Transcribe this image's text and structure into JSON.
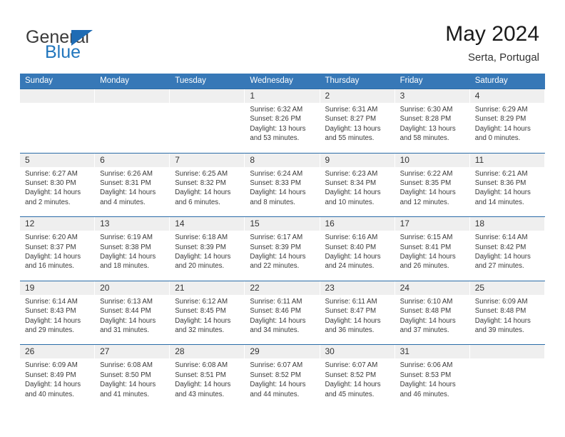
{
  "brand": {
    "name_top": "General",
    "name_bottom": "Blue",
    "triangle_icon": "blue-triangle-icon",
    "color_top": "#3b3b3b",
    "color_bottom": "#2176bd"
  },
  "header": {
    "title": "May 2024",
    "subtitle": "Serta, Portugal"
  },
  "theme": {
    "header_row_bg": "#3778b7",
    "row_separator": "#2b6ca8",
    "day_band_bg": "#efefef",
    "text": "#3a3a3a"
  },
  "calendar": {
    "day_names": [
      "Sunday",
      "Monday",
      "Tuesday",
      "Wednesday",
      "Thursday",
      "Friday",
      "Saturday"
    ],
    "labels": {
      "sunrise": "Sunrise:",
      "sunset": "Sunset:",
      "daylight": "Daylight:"
    },
    "weeks": [
      [
        {
          "day": "",
          "empty": true
        },
        {
          "day": "",
          "empty": true
        },
        {
          "day": "",
          "empty": true
        },
        {
          "day": "1",
          "sunrise": "Sunrise: 6:32 AM",
          "sunset": "Sunset: 8:26 PM",
          "daylight1": "Daylight: 13 hours",
          "daylight2": "and 53 minutes."
        },
        {
          "day": "2",
          "sunrise": "Sunrise: 6:31 AM",
          "sunset": "Sunset: 8:27 PM",
          "daylight1": "Daylight: 13 hours",
          "daylight2": "and 55 minutes."
        },
        {
          "day": "3",
          "sunrise": "Sunrise: 6:30 AM",
          "sunset": "Sunset: 8:28 PM",
          "daylight1": "Daylight: 13 hours",
          "daylight2": "and 58 minutes."
        },
        {
          "day": "4",
          "sunrise": "Sunrise: 6:29 AM",
          "sunset": "Sunset: 8:29 PM",
          "daylight1": "Daylight: 14 hours",
          "daylight2": "and 0 minutes."
        }
      ],
      [
        {
          "day": "5",
          "sunrise": "Sunrise: 6:27 AM",
          "sunset": "Sunset: 8:30 PM",
          "daylight1": "Daylight: 14 hours",
          "daylight2": "and 2 minutes."
        },
        {
          "day": "6",
          "sunrise": "Sunrise: 6:26 AM",
          "sunset": "Sunset: 8:31 PM",
          "daylight1": "Daylight: 14 hours",
          "daylight2": "and 4 minutes."
        },
        {
          "day": "7",
          "sunrise": "Sunrise: 6:25 AM",
          "sunset": "Sunset: 8:32 PM",
          "daylight1": "Daylight: 14 hours",
          "daylight2": "and 6 minutes."
        },
        {
          "day": "8",
          "sunrise": "Sunrise: 6:24 AM",
          "sunset": "Sunset: 8:33 PM",
          "daylight1": "Daylight: 14 hours",
          "daylight2": "and 8 minutes."
        },
        {
          "day": "9",
          "sunrise": "Sunrise: 6:23 AM",
          "sunset": "Sunset: 8:34 PM",
          "daylight1": "Daylight: 14 hours",
          "daylight2": "and 10 minutes."
        },
        {
          "day": "10",
          "sunrise": "Sunrise: 6:22 AM",
          "sunset": "Sunset: 8:35 PM",
          "daylight1": "Daylight: 14 hours",
          "daylight2": "and 12 minutes."
        },
        {
          "day": "11",
          "sunrise": "Sunrise: 6:21 AM",
          "sunset": "Sunset: 8:36 PM",
          "daylight1": "Daylight: 14 hours",
          "daylight2": "and 14 minutes."
        }
      ],
      [
        {
          "day": "12",
          "sunrise": "Sunrise: 6:20 AM",
          "sunset": "Sunset: 8:37 PM",
          "daylight1": "Daylight: 14 hours",
          "daylight2": "and 16 minutes."
        },
        {
          "day": "13",
          "sunrise": "Sunrise: 6:19 AM",
          "sunset": "Sunset: 8:38 PM",
          "daylight1": "Daylight: 14 hours",
          "daylight2": "and 18 minutes."
        },
        {
          "day": "14",
          "sunrise": "Sunrise: 6:18 AM",
          "sunset": "Sunset: 8:39 PM",
          "daylight1": "Daylight: 14 hours",
          "daylight2": "and 20 minutes."
        },
        {
          "day": "15",
          "sunrise": "Sunrise: 6:17 AM",
          "sunset": "Sunset: 8:39 PM",
          "daylight1": "Daylight: 14 hours",
          "daylight2": "and 22 minutes."
        },
        {
          "day": "16",
          "sunrise": "Sunrise: 6:16 AM",
          "sunset": "Sunset: 8:40 PM",
          "daylight1": "Daylight: 14 hours",
          "daylight2": "and 24 minutes."
        },
        {
          "day": "17",
          "sunrise": "Sunrise: 6:15 AM",
          "sunset": "Sunset: 8:41 PM",
          "daylight1": "Daylight: 14 hours",
          "daylight2": "and 26 minutes."
        },
        {
          "day": "18",
          "sunrise": "Sunrise: 6:14 AM",
          "sunset": "Sunset: 8:42 PM",
          "daylight1": "Daylight: 14 hours",
          "daylight2": "and 27 minutes."
        }
      ],
      [
        {
          "day": "19",
          "sunrise": "Sunrise: 6:14 AM",
          "sunset": "Sunset: 8:43 PM",
          "daylight1": "Daylight: 14 hours",
          "daylight2": "and 29 minutes."
        },
        {
          "day": "20",
          "sunrise": "Sunrise: 6:13 AM",
          "sunset": "Sunset: 8:44 PM",
          "daylight1": "Daylight: 14 hours",
          "daylight2": "and 31 minutes."
        },
        {
          "day": "21",
          "sunrise": "Sunrise: 6:12 AM",
          "sunset": "Sunset: 8:45 PM",
          "daylight1": "Daylight: 14 hours",
          "daylight2": "and 32 minutes."
        },
        {
          "day": "22",
          "sunrise": "Sunrise: 6:11 AM",
          "sunset": "Sunset: 8:46 PM",
          "daylight1": "Daylight: 14 hours",
          "daylight2": "and 34 minutes."
        },
        {
          "day": "23",
          "sunrise": "Sunrise: 6:11 AM",
          "sunset": "Sunset: 8:47 PM",
          "daylight1": "Daylight: 14 hours",
          "daylight2": "and 36 minutes."
        },
        {
          "day": "24",
          "sunrise": "Sunrise: 6:10 AM",
          "sunset": "Sunset: 8:48 PM",
          "daylight1": "Daylight: 14 hours",
          "daylight2": "and 37 minutes."
        },
        {
          "day": "25",
          "sunrise": "Sunrise: 6:09 AM",
          "sunset": "Sunset: 8:48 PM",
          "daylight1": "Daylight: 14 hours",
          "daylight2": "and 39 minutes."
        }
      ],
      [
        {
          "day": "26",
          "sunrise": "Sunrise: 6:09 AM",
          "sunset": "Sunset: 8:49 PM",
          "daylight1": "Daylight: 14 hours",
          "daylight2": "and 40 minutes."
        },
        {
          "day": "27",
          "sunrise": "Sunrise: 6:08 AM",
          "sunset": "Sunset: 8:50 PM",
          "daylight1": "Daylight: 14 hours",
          "daylight2": "and 41 minutes."
        },
        {
          "day": "28",
          "sunrise": "Sunrise: 6:08 AM",
          "sunset": "Sunset: 8:51 PM",
          "daylight1": "Daylight: 14 hours",
          "daylight2": "and 43 minutes."
        },
        {
          "day": "29",
          "sunrise": "Sunrise: 6:07 AM",
          "sunset": "Sunset: 8:52 PM",
          "daylight1": "Daylight: 14 hours",
          "daylight2": "and 44 minutes."
        },
        {
          "day": "30",
          "sunrise": "Sunrise: 6:07 AM",
          "sunset": "Sunset: 8:52 PM",
          "daylight1": "Daylight: 14 hours",
          "daylight2": "and 45 minutes."
        },
        {
          "day": "31",
          "sunrise": "Sunrise: 6:06 AM",
          "sunset": "Sunset: 8:53 PM",
          "daylight1": "Daylight: 14 hours",
          "daylight2": "and 46 minutes."
        },
        {
          "day": "",
          "empty": true
        }
      ]
    ]
  }
}
